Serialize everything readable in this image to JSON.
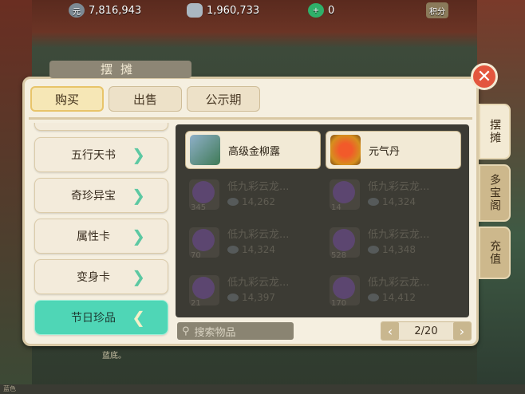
{
  "resources": {
    "silver": "7,816,943",
    "gold": "1,960,733",
    "jade": "0",
    "extra_label": "积分"
  },
  "panel": {
    "title": "摆摊",
    "tabs": [
      "购买",
      "出售",
      "公示期"
    ],
    "categories": [
      "五行天书",
      "奇珍异宝",
      "属性卡",
      "变身卡",
      "节日珍品"
    ],
    "active_category": "节日珍品",
    "items_available": [
      {
        "name": "高级金柳露"
      },
      {
        "name": "元气丹"
      }
    ],
    "items_dimmed": [
      {
        "name": "低九彩云龙...",
        "qty": "345",
        "price": "14,262"
      },
      {
        "name": "低九彩云龙...",
        "qty": "14",
        "price": "14,324"
      },
      {
        "name": "低九彩云龙...",
        "qty": "70",
        "price": "14,324"
      },
      {
        "name": "低九彩云龙...",
        "qty": "528",
        "price": "14,348"
      },
      {
        "name": "低九彩云龙...",
        "qty": "21",
        "price": "14,397"
      },
      {
        "name": "低九彩云龙...",
        "qty": "170",
        "price": "14,412"
      }
    ],
    "search_placeholder": "搜索物品",
    "page": "2/20"
  },
  "side_tabs": [
    "摆摊",
    "多宝阁",
    "充值"
  ],
  "bottom_hint": "蓝底。",
  "bottom_label": "蓝色"
}
